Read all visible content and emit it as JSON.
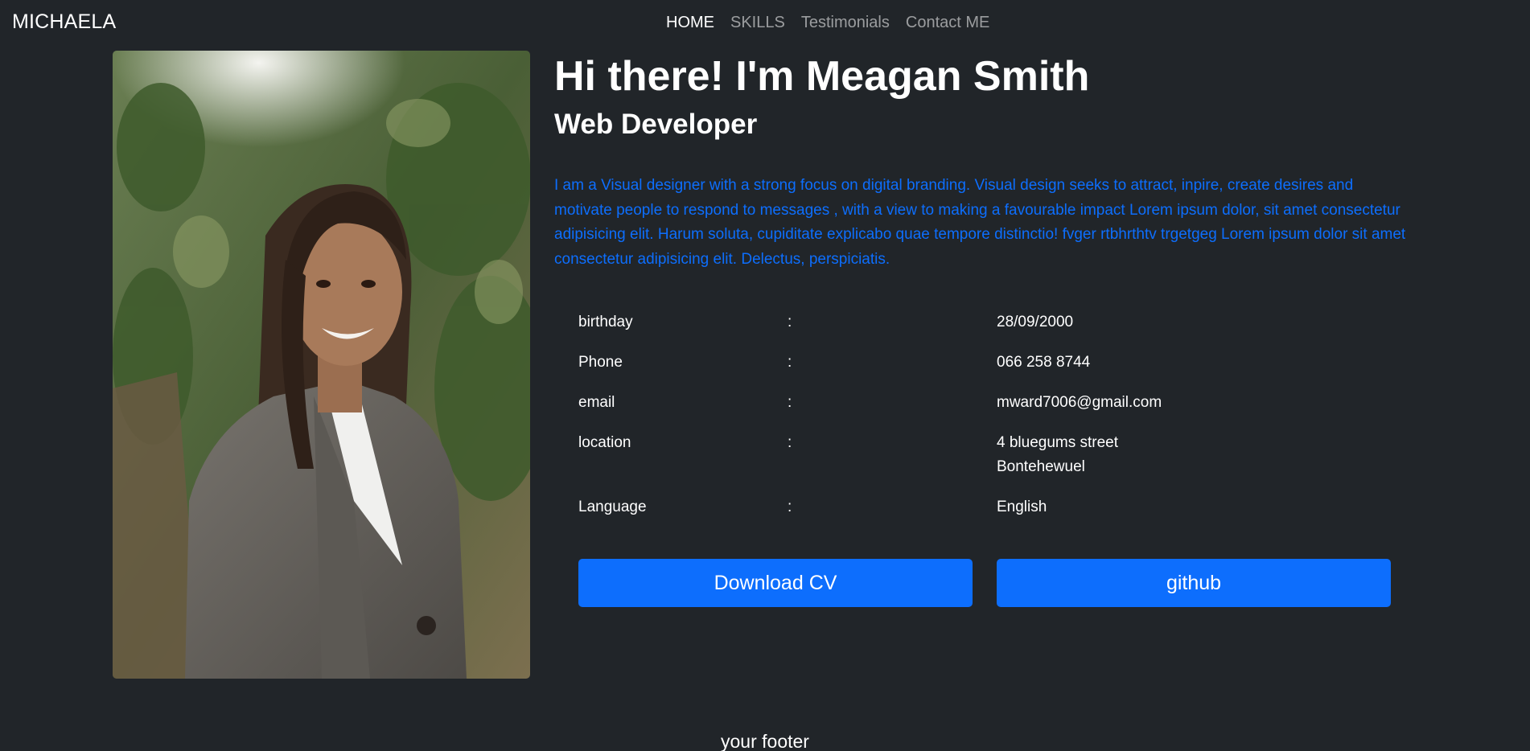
{
  "nav": {
    "brand": "MICHAELA",
    "links": [
      {
        "label": "HOME",
        "active": true
      },
      {
        "label": "SKILLS",
        "active": false
      },
      {
        "label": "Testimonials",
        "active": false
      },
      {
        "label": "Contact ME",
        "active": false
      }
    ]
  },
  "hero": {
    "title": "Hi there! I'm Meagan Smith",
    "subtitle": "Web Developer",
    "bio": "I am a Visual designer with a strong focus on digital branding. Visual design seeks to attract, inpire, create desires and motivate people to respond to messages , with a view to making a favourable impact Lorem ipsum dolor, sit amet consectetur adipisicing elit. Harum soluta, cupiditate explicabo quae tempore distinctio! fvger rtbhrthtv trgetgeg Lorem ipsum dolor sit amet consectetur adipisicing elit. Delectus, perspiciatis."
  },
  "info": {
    "separator": ":",
    "rows": [
      {
        "key": "birthday",
        "value": "28/09/2000"
      },
      {
        "key": "Phone",
        "value": "066 258 8744"
      },
      {
        "key": "email",
        "value": "mward7006@gmail.com"
      },
      {
        "key": "location",
        "value": "4 bluegums street",
        "value2": "Bontehewuel"
      },
      {
        "key": "Language",
        "value": "English"
      }
    ]
  },
  "buttons": {
    "download_cv": "Download CV",
    "github": "github"
  },
  "footer": {
    "text": "your footer"
  },
  "colors": {
    "background": "#212529",
    "accent": "#0d6efd"
  }
}
